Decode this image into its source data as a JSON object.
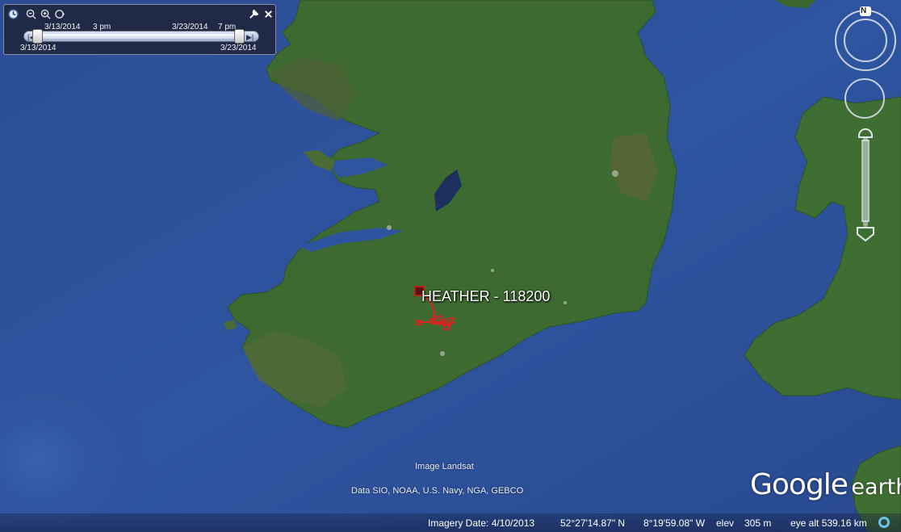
{
  "time_slider": {
    "start_date_top": "3/13/2014",
    "start_time_top": "3 pm",
    "end_date_top": "3/23/2014",
    "end_time_top": "7 pm",
    "range_start": "3/13/2014",
    "range_end": "3/23/2014",
    "icons": [
      "clock-icon",
      "zoom-out-icon",
      "zoom-in-icon",
      "play-icon",
      "wrench-icon",
      "close-icon"
    ]
  },
  "navigation": {
    "north_label": "N"
  },
  "placemark": {
    "label": "HEATHER - 118200",
    "color": "#e32020"
  },
  "attribution": {
    "imagery_source": "Image Landsat",
    "data_sources": "Data SIO, NOAA, U.S. Navy, NGA, GEBCO"
  },
  "logo": {
    "google": "Google",
    "earth": "earth"
  },
  "status_bar": {
    "imagery_date": "Imagery Date: 4/10/2013",
    "latitude": "52°27'14.87\" N",
    "longitude": "8°19'59.08\" W",
    "elev_label": "elev",
    "elev_value": "305 m",
    "eye_alt": "eye alt 539.16 km"
  },
  "colors": {
    "ocean": "#2d4f9a",
    "land": "#3f6a32",
    "track": "#e32020"
  }
}
